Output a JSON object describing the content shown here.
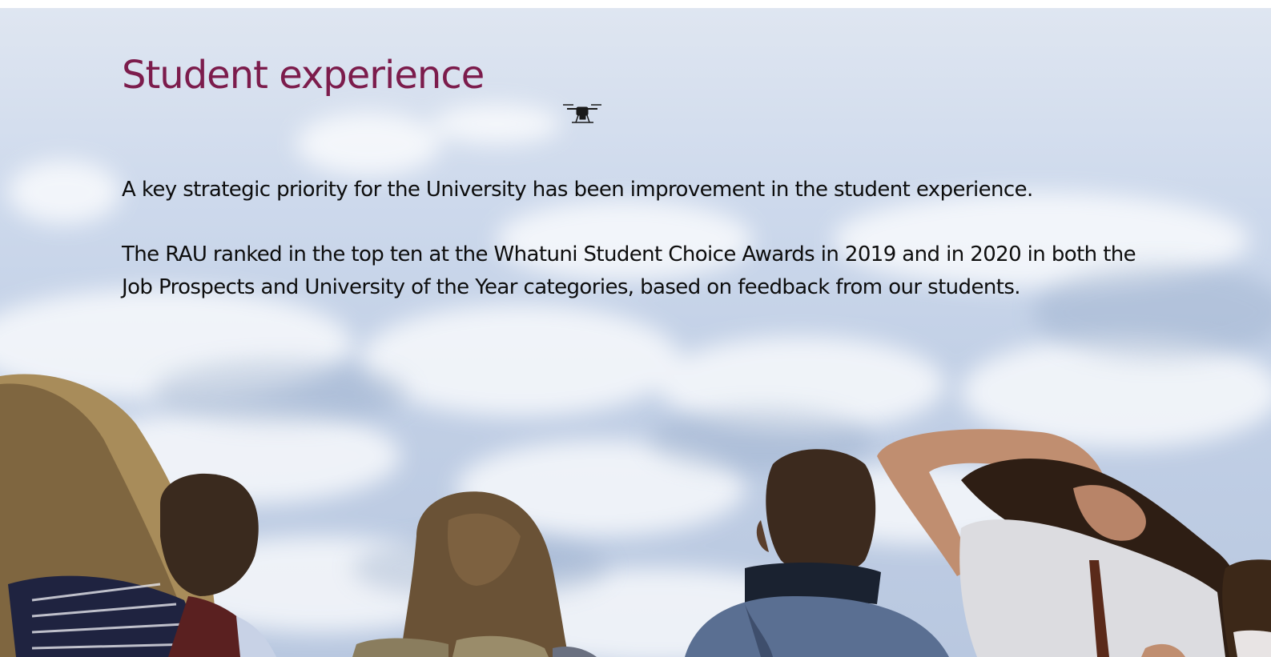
{
  "slide": {
    "title": "Student experience",
    "paragraphs": [
      "A key strategic priority for the University has been improvement in the student experience.",
      "The RAU ranked in the top ten at the Whatuni Student Choice Awards in 2019 and in 2020 in both the Job Prospects and University of the Year categories, based on feedback from our students."
    ]
  },
  "colors": {
    "title": "#7c1c4c",
    "body_text": "#0d0d0d",
    "sky": "#c2d0e6"
  },
  "background_photo": {
    "subject": "students silhouetted against a cloudy sky watching a drone",
    "icons": [
      "drone-icon"
    ]
  }
}
